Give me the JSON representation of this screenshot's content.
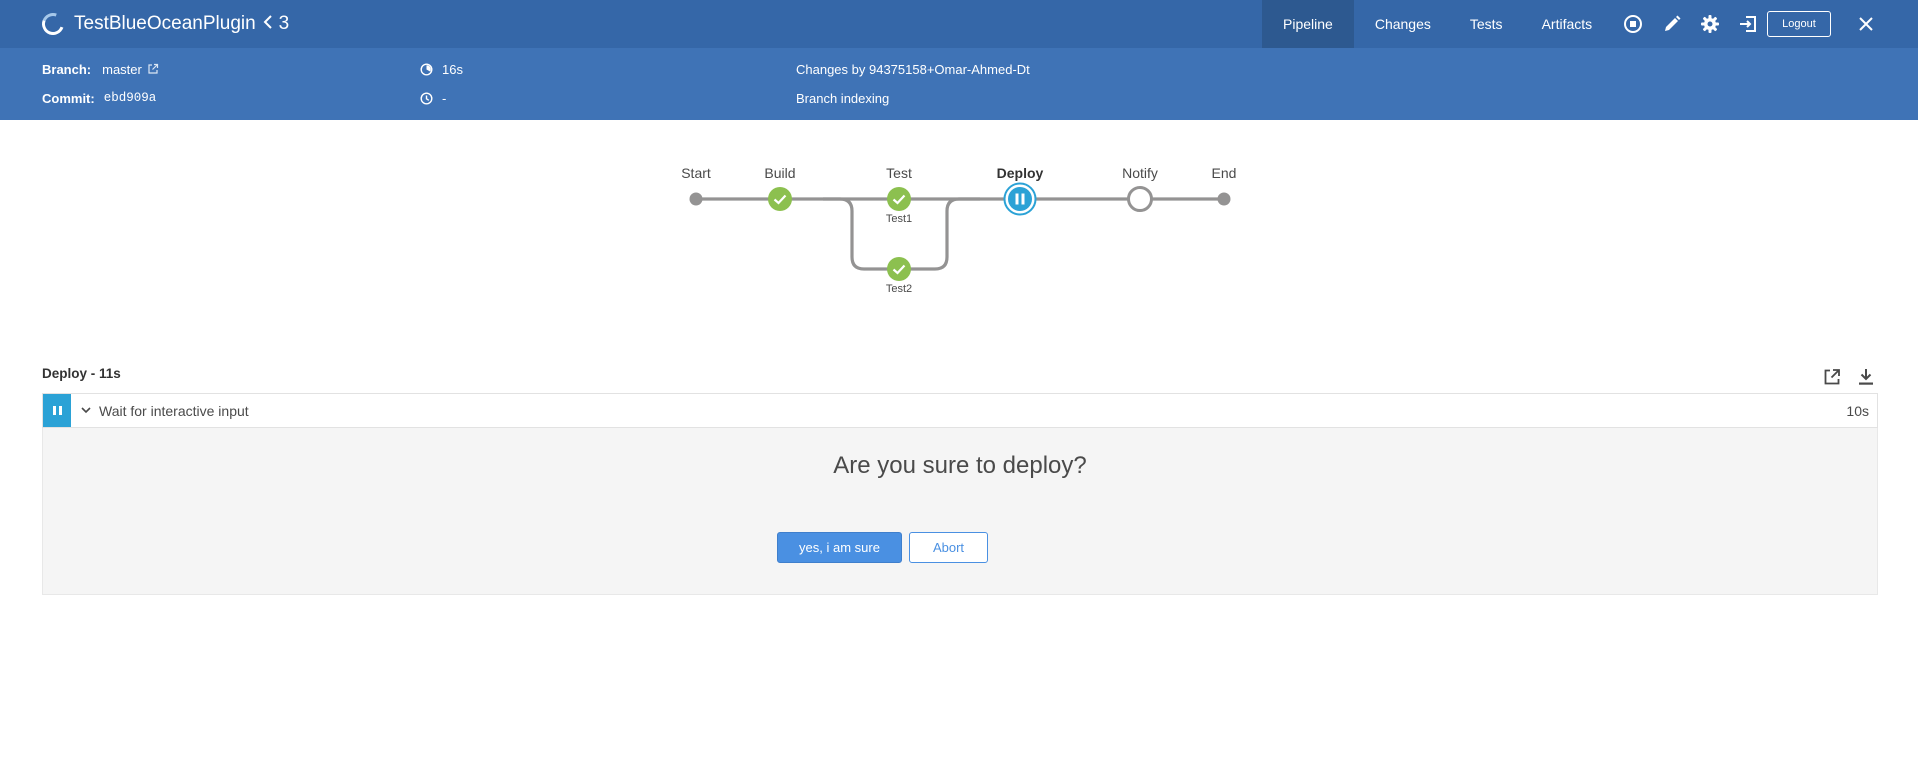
{
  "header": {
    "pipeline_name": "TestBlueOceanPlugin",
    "run_number": "3",
    "tabs": [
      {
        "label": "Pipeline",
        "active": true
      },
      {
        "label": "Changes",
        "active": false
      },
      {
        "label": "Tests",
        "active": false
      },
      {
        "label": "Artifacts",
        "active": false
      }
    ],
    "icons": [
      "stop-icon",
      "edit-icon",
      "gear-icon",
      "sign-in-icon",
      "close-icon"
    ],
    "logout_label": "Logout"
  },
  "run_info": {
    "branch_label": "Branch:",
    "branch_value": "master",
    "commit_label": "Commit:",
    "commit_value": "ebd909a",
    "duration": "16s",
    "finished": "-",
    "changes_by": "Changes by 94375158+Omar-Ahmed-Dt",
    "cause": "Branch indexing"
  },
  "pipeline_graph": {
    "stages": [
      {
        "name": "Start",
        "status": "start"
      },
      {
        "name": "Build",
        "status": "success"
      },
      {
        "name": "Test",
        "status": "success",
        "parallel": [
          {
            "name": "Test1",
            "status": "success"
          },
          {
            "name": "Test2",
            "status": "success"
          }
        ]
      },
      {
        "name": "Deploy",
        "status": "paused",
        "current": true
      },
      {
        "name": "Notify",
        "status": "not_built"
      },
      {
        "name": "End",
        "status": "end"
      }
    ]
  },
  "log": {
    "title": "Deploy - 11s",
    "step_name": "Wait for interactive input",
    "step_duration": "10s",
    "input_message": "Are you sure to deploy?",
    "proceed_label": "yes, i am sure",
    "abort_label": "Abort"
  },
  "colors": {
    "header_bg": "#3567a8",
    "subheader_bg": "#3f73b6",
    "success": "#8cc04f",
    "paused": "#2ba2d6",
    "primary_button": "#4a90e2"
  }
}
